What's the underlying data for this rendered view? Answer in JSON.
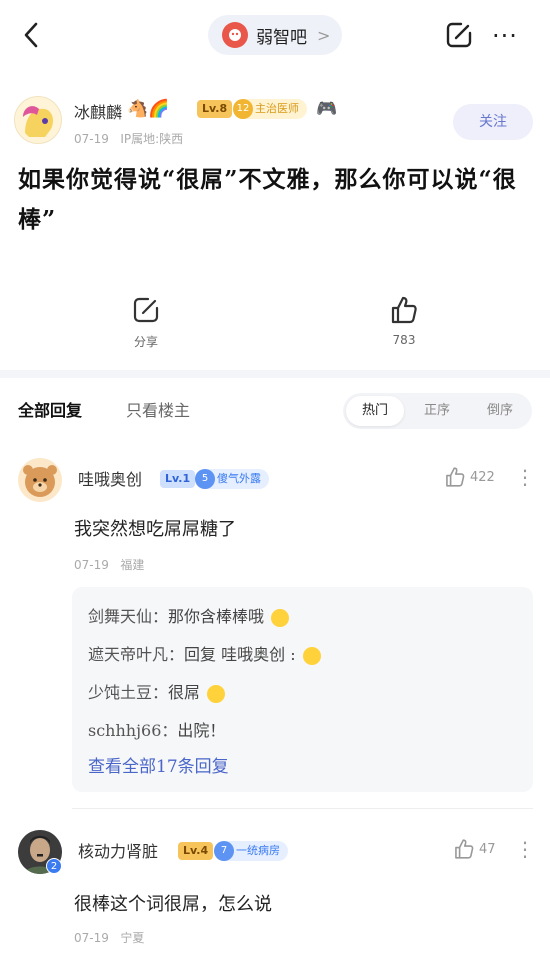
{
  "topbar": {
    "forum_name": "弱智吧",
    "chevron": ">",
    "more": "···"
  },
  "author": {
    "name": "冰麒麟",
    "emoji": "🐴🌈",
    "level": "Lv.8",
    "tag_num": "12",
    "tag_text": "主治医师",
    "extra_emoji": "🎮",
    "date": "07-19",
    "ip": "IP属地:陕西",
    "follow_label": "关注"
  },
  "post": {
    "title": "如果你觉得说“很屌”不文雅，那么你可以说“很棒”"
  },
  "actions": {
    "share_label": "分享",
    "like_count": "783"
  },
  "reply_header": {
    "all": "全部回复",
    "owner_only": "只看楼主",
    "sort": [
      "热门",
      "正序",
      "倒序"
    ],
    "active_sort": "热门"
  },
  "comments": [
    {
      "name": "哇哦奥创",
      "level": "Lv.1",
      "tag_num": "5",
      "tag_text": "傻气外露",
      "likes": "422",
      "text": "我突然想吃屌屌糖了",
      "date": "07-19",
      "location": "福建",
      "subreplies": [
        {
          "user": "剑舞天仙：",
          "text": "那你含棒棒哦"
        },
        {
          "user": "遮天帝叶凡：",
          "text": "回复 哇哦奥创 :"
        },
        {
          "user": "少饨土豆：",
          "text": "很屌"
        },
        {
          "user": "schhhj66：",
          "text": "出院！"
        }
      ],
      "view_all": "查看全部17条回复"
    },
    {
      "name": "核动力肾脏",
      "level": "Lv.4",
      "tag_num": "7",
      "tag_text": "一统病房",
      "likes": "47",
      "text": "很棒这个词很屌，怎么说",
      "date": "07-19",
      "location": "宁夏",
      "badge": "2"
    }
  ],
  "colors": {
    "accent_blue": "#4a66c9",
    "level_orange": "#f7c35b",
    "tag_gold": "#d99a1a",
    "tag_blue": "#3a7bf2"
  },
  "icons": [
    "back-icon",
    "share-icon",
    "more-icon",
    "like-icon"
  ]
}
